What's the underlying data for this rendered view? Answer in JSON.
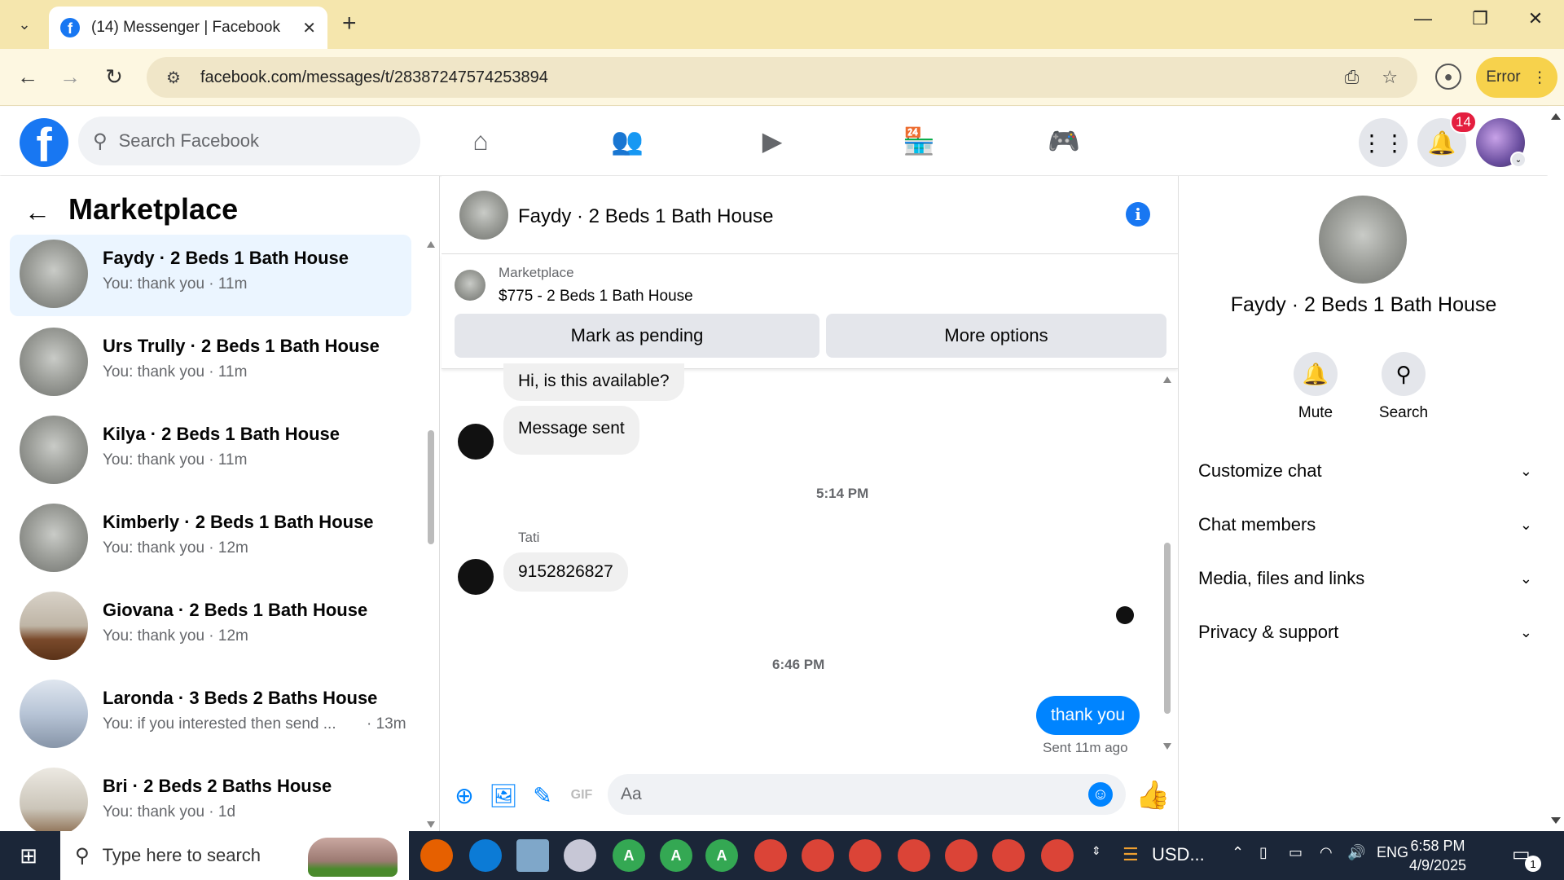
{
  "browser": {
    "tab_title": "(14) Messenger | Facebook",
    "url": "facebook.com/messages/t/28387247574253894",
    "error_label": "Error"
  },
  "fb": {
    "search_placeholder": "Search Facebook",
    "notification_count": "14"
  },
  "left": {
    "title": "Marketplace",
    "conversations": [
      {
        "name": "Faydy · 2 Beds 1 Bath House",
        "preview": "You: thank you · 11m",
        "time": "",
        "active": true
      },
      {
        "name": "Urs Trully · 2 Beds 1 Bath House",
        "preview": "You: thank you · 11m",
        "time": ""
      },
      {
        "name": "Kilya · 2 Beds 1 Bath House",
        "preview": "You: thank you · 11m",
        "time": ""
      },
      {
        "name": "Kimberly · 2 Beds 1 Bath House",
        "preview": "You: thank you · 12m",
        "time": ""
      },
      {
        "name": "Giovana · 2 Beds 1 Bath House",
        "preview": "You: thank you · 12m",
        "time": ""
      },
      {
        "name": "Laronda · 3 Beds 2 Baths House",
        "preview": "You: if you interested then send ...",
        "time": "· 13m"
      },
      {
        "name": "Bri · 2 Beds 2 Baths House",
        "preview": "You: thank you · 1d",
        "time": ""
      }
    ]
  },
  "chat": {
    "title": "Faydy · 2 Beds 1 Bath House",
    "marketplace_label": "Marketplace",
    "listing": "$775 - 2 Beds 1 Bath House",
    "mark_pending": "Mark as pending",
    "more_options": "More options",
    "messages": {
      "m1": "Hi, is this available?",
      "m2": "Message sent",
      "ts1": "5:14 PM",
      "sender": "Tati",
      "m3": "9152826827",
      "ts2": "6:46 PM",
      "mine": "thank you",
      "sent": "Sent 11m ago"
    },
    "composer_placeholder": "Aa"
  },
  "right": {
    "name": "Faydy · 2 Beds 1 Bath House",
    "mute": "Mute",
    "search": "Search",
    "sections": [
      "Customize chat",
      "Chat members",
      "Media, files and links",
      "Privacy & support"
    ]
  },
  "taskbar": {
    "search_placeholder": "Type here to search",
    "weather": "USD...",
    "lang": "ENG",
    "time": "6:58 PM",
    "date": "4/9/2025",
    "notif_count": "1"
  }
}
